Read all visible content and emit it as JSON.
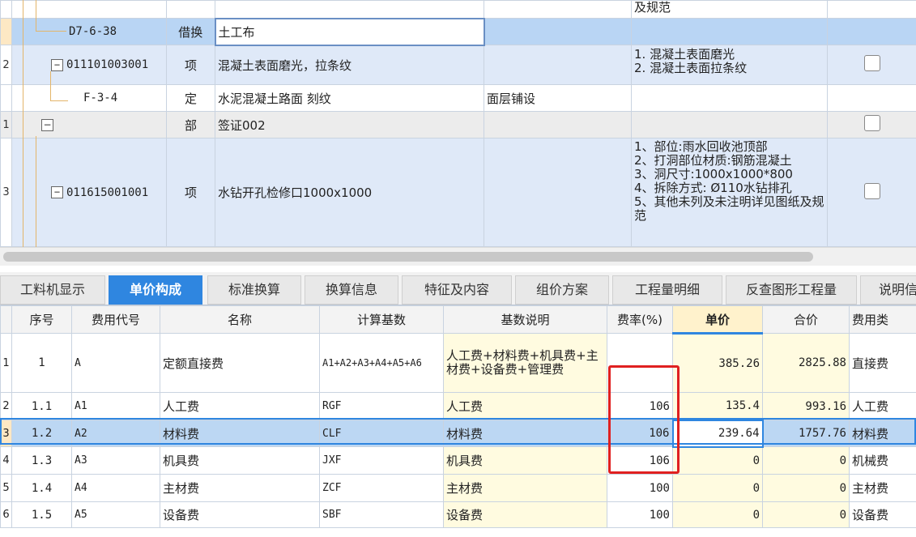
{
  "top": {
    "partial": {
      "desc": "及规范"
    },
    "rows": [
      {
        "rownum": "",
        "code": "D7-6-38",
        "type": "借换",
        "name": "土工布",
        "feature": "",
        "desc": ""
      },
      {
        "rownum": "2",
        "code": "011101003001",
        "type": "项",
        "name": "混凝土表面磨光，拉条纹",
        "feature": "",
        "desc": "1. 混凝土表面磨光\n2. 混凝土表面拉条纹"
      },
      {
        "rownum": "",
        "code": "F-3-4",
        "type": "定",
        "name": "水泥混凝土路面 刻纹",
        "feature": "面层铺设",
        "desc": ""
      },
      {
        "rownum": "1",
        "code": "",
        "type": "部",
        "name": "签证002",
        "feature": "",
        "desc": ""
      },
      {
        "rownum": "3",
        "code": "011615001001",
        "type": "项",
        "name": "水钻开孔检修口1000x1000",
        "feature": "",
        "desc": "1、部位:雨水回收池顶部\n2、打洞部位材质:钢筋混凝土\n3、洞尺寸:1000x1000*800\n4、拆除方式: Ø110水钻排孔\n5、其他未列及未注明详见图纸及规范"
      }
    ]
  },
  "tabs": [
    "工料机显示",
    "单价构成",
    "标准换算",
    "换算信息",
    "特征及内容",
    "组价方案",
    "工程量明细",
    "反查图形工程量",
    "说明信"
  ],
  "active_tab": "单价构成",
  "grid": {
    "headers": [
      "序号",
      "费用代号",
      "名称",
      "计算基数",
      "基数说明",
      "费率(%)",
      "单价",
      "合价",
      "费用类"
    ],
    "rows": [
      {
        "rownum": "1",
        "seq": "1",
        "code": "A",
        "name": "定额直接费",
        "base": "A1+A2+A3+A4+A5+A6",
        "base_desc": "人工费+材料费+机具费+主材费+设备费+管理费",
        "rate": "",
        "price": "385.26",
        "total": "2825.88",
        "type": "直接费"
      },
      {
        "rownum": "2",
        "seq": "1.1",
        "code": "A1",
        "name": "人工费",
        "base": "RGF",
        "base_desc": "人工费",
        "rate": "106",
        "price": "135.4",
        "total": "993.16",
        "type": "人工费"
      },
      {
        "rownum": "3",
        "seq": "1.2",
        "code": "A2",
        "name": "材料费",
        "base": "CLF",
        "base_desc": "材料费",
        "rate": "106",
        "price": "239.64",
        "total": "1757.76",
        "type": "材料费"
      },
      {
        "rownum": "4",
        "seq": "1.3",
        "code": "A3",
        "name": "机具费",
        "base": "JXF",
        "base_desc": "机具费",
        "rate": "106",
        "price": "0",
        "total": "0",
        "type": "机械费"
      },
      {
        "rownum": "5",
        "seq": "1.4",
        "code": "A4",
        "name": "主材费",
        "base": "ZCF",
        "base_desc": "主材费",
        "rate": "100",
        "price": "0",
        "total": "0",
        "type": "主材费"
      },
      {
        "rownum": "6",
        "seq": "1.5",
        "code": "A5",
        "name": "设备费",
        "base": "SBF",
        "base_desc": "设备费",
        "rate": "100",
        "price": "0",
        "total": "0",
        "type": "设备费"
      }
    ]
  },
  "colors": {
    "accent": "#2f86e0",
    "highlight_box": "#e02020"
  }
}
